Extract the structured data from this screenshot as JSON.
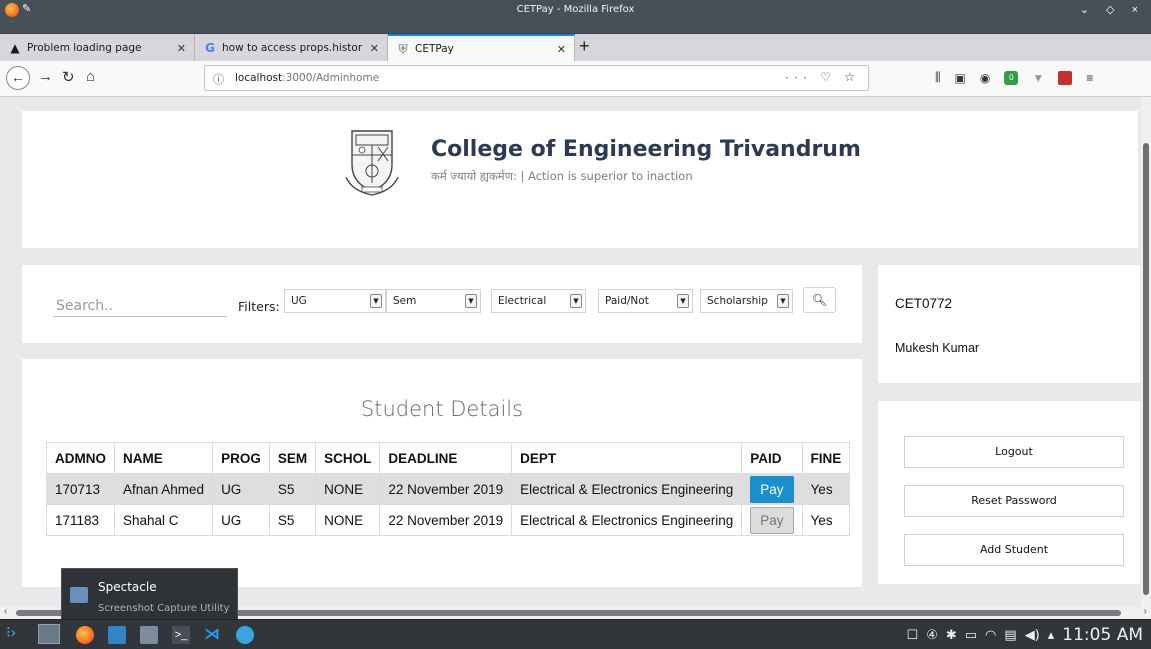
{
  "window": {
    "title": "CETPay - Mozilla Firefox",
    "controls": "⌄ ◇ ×"
  },
  "tabs": [
    {
      "icon": "warning-icon",
      "glyph": "▲",
      "label": "Problem loading page"
    },
    {
      "icon": "google-icon",
      "glyph": "G",
      "label": "how to access props.histor"
    },
    {
      "icon": "cetpay-icon",
      "glyph": "⛨",
      "label": "CETPay"
    }
  ],
  "nav": {
    "url_host": "localhost",
    "url_path": ":3000/Adminhome",
    "page_actions": "··· ♡ ☆"
  },
  "header": {
    "college_name": "College of Engineering Trivandrum",
    "motto": "कर्म ज्यायो ह्यकर्मण: | Action is superior to inaction"
  },
  "filters": {
    "search_placeholder": "Search..",
    "label": "Filters:",
    "selects": [
      "UG",
      "Sem",
      "Electrical",
      "Paid/Not",
      "Scholarship"
    ]
  },
  "user": {
    "id": "CET0772",
    "name": "Mukesh Kumar"
  },
  "students": {
    "title": "Student Details",
    "columns": [
      "ADMNO",
      "NAME",
      "PROG",
      "SEM",
      "SCHOL",
      "DEADLINE",
      "DEPT",
      "PAID",
      "FINE"
    ],
    "rows": [
      {
        "admno": "170713",
        "name": "Afnan Ahmed",
        "prog": "UG",
        "sem": "S5",
        "schol": "NONE",
        "deadline": "22 November 2019",
        "dept": "Electrical & Electronics Engineering",
        "paid": "Pay",
        "fine": "Yes"
      },
      {
        "admno": "171183",
        "name": "Shahal C",
        "prog": "UG",
        "sem": "S5",
        "schol": "NONE",
        "deadline": "22 November 2019",
        "dept": "Electrical & Electronics Engineering",
        "paid": "Pay",
        "fine": "Yes"
      }
    ]
  },
  "actions": [
    "Logout",
    "Reset Password",
    "Add Student"
  ],
  "tooltip": {
    "title": "Spectacle",
    "subtitle": "Screenshot Capture Utility"
  },
  "taskbar": {
    "clock": "11:05 AM"
  },
  "colors": {
    "pay_active": "#1a8fce",
    "tab_accent": "#0a84ff",
    "title_bar": "#475057"
  }
}
